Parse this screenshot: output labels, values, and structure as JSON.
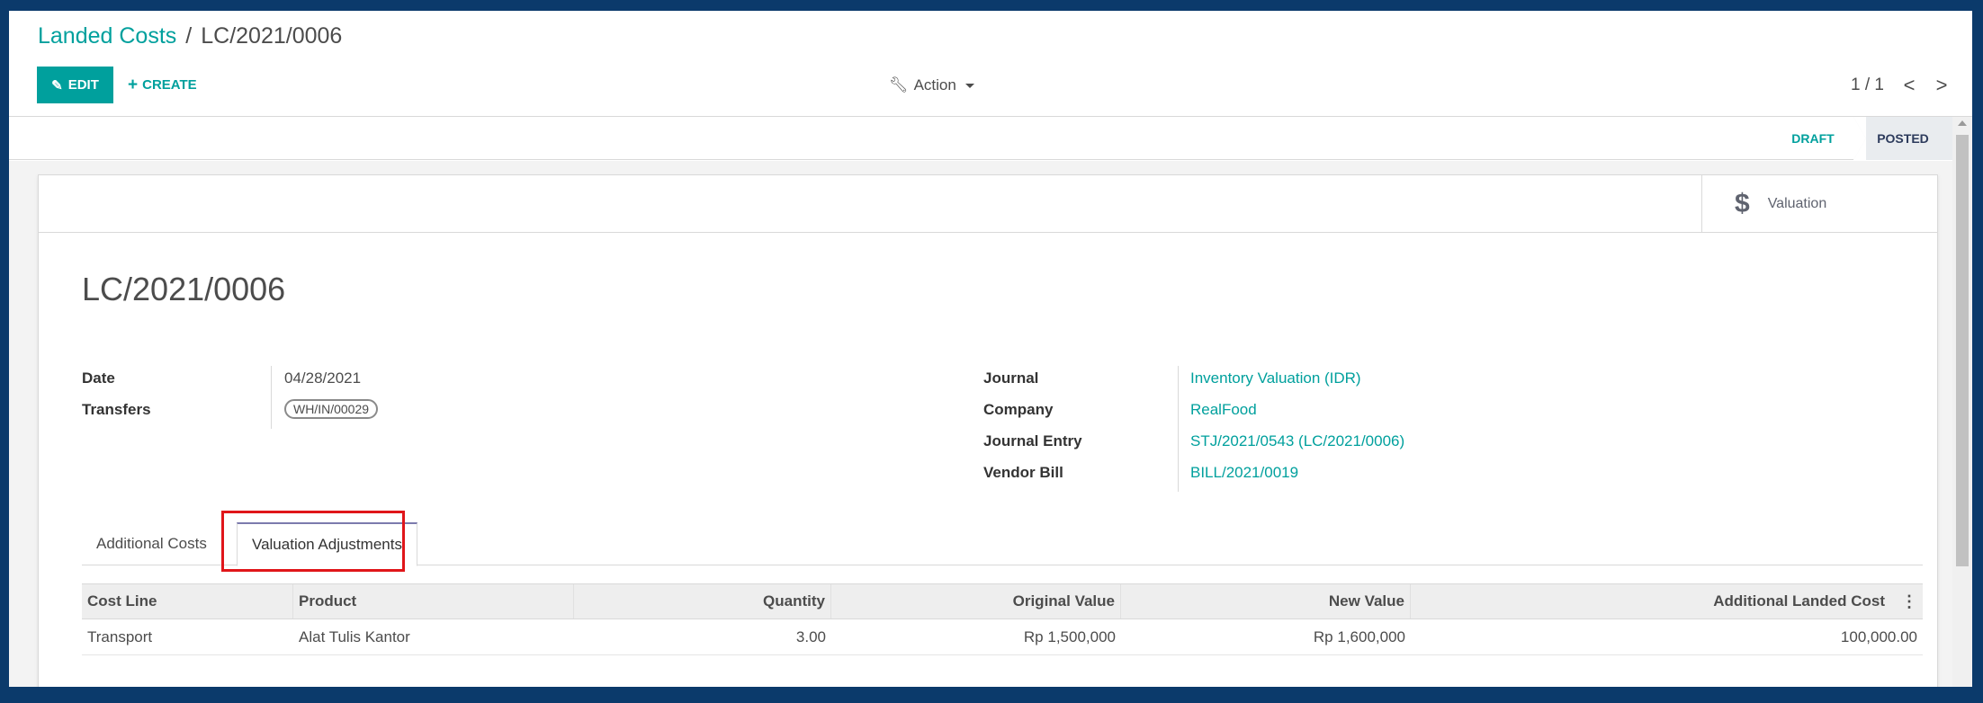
{
  "breadcrumb": {
    "parent": "Landed Costs",
    "separator": "/",
    "current": "LC/2021/0006"
  },
  "toolbar": {
    "edit_label": "EDIT",
    "create_label": "CREATE",
    "action_label": "Action"
  },
  "pager": {
    "value": "1 / 1",
    "prev": "<",
    "next": ">"
  },
  "statusbar": {
    "stages": [
      "DRAFT",
      "POSTED"
    ],
    "active": "POSTED"
  },
  "button_box": {
    "valuation_label": "Valuation",
    "valuation_icon": "$"
  },
  "record": {
    "title": "LC/2021/0006",
    "left_fields": {
      "date_label": "Date",
      "date_value": "04/28/2021",
      "transfers_label": "Transfers",
      "transfers_value": "WH/IN/00029"
    },
    "right_fields": {
      "journal_label": "Journal",
      "journal_value": "Inventory Valuation (IDR)",
      "company_label": "Company",
      "company_value": "RealFood",
      "journal_entry_label": "Journal Entry",
      "journal_entry_value": "STJ/2021/0543 (LC/2021/0006)",
      "vendor_bill_label": "Vendor Bill",
      "vendor_bill_value": "BILL/2021/0019"
    }
  },
  "tabs": [
    "Additional Costs",
    "Valuation Adjustments"
  ],
  "active_tab": "Valuation Adjustments",
  "table": {
    "headers": [
      "Cost Line",
      "Product",
      "Quantity",
      "Original Value",
      "New Value",
      "Additional Landed Cost"
    ],
    "rows": [
      [
        "Transport",
        "Alat Tulis Kantor",
        "3.00",
        "Rp 1,500,000",
        "Rp 1,600,000",
        "100,000.00"
      ]
    ]
  },
  "colors": {
    "accent": "#00a09d",
    "frame": "#0b3a6b",
    "highlight": "#e0161a",
    "tab_accent": "#7c7bad"
  }
}
